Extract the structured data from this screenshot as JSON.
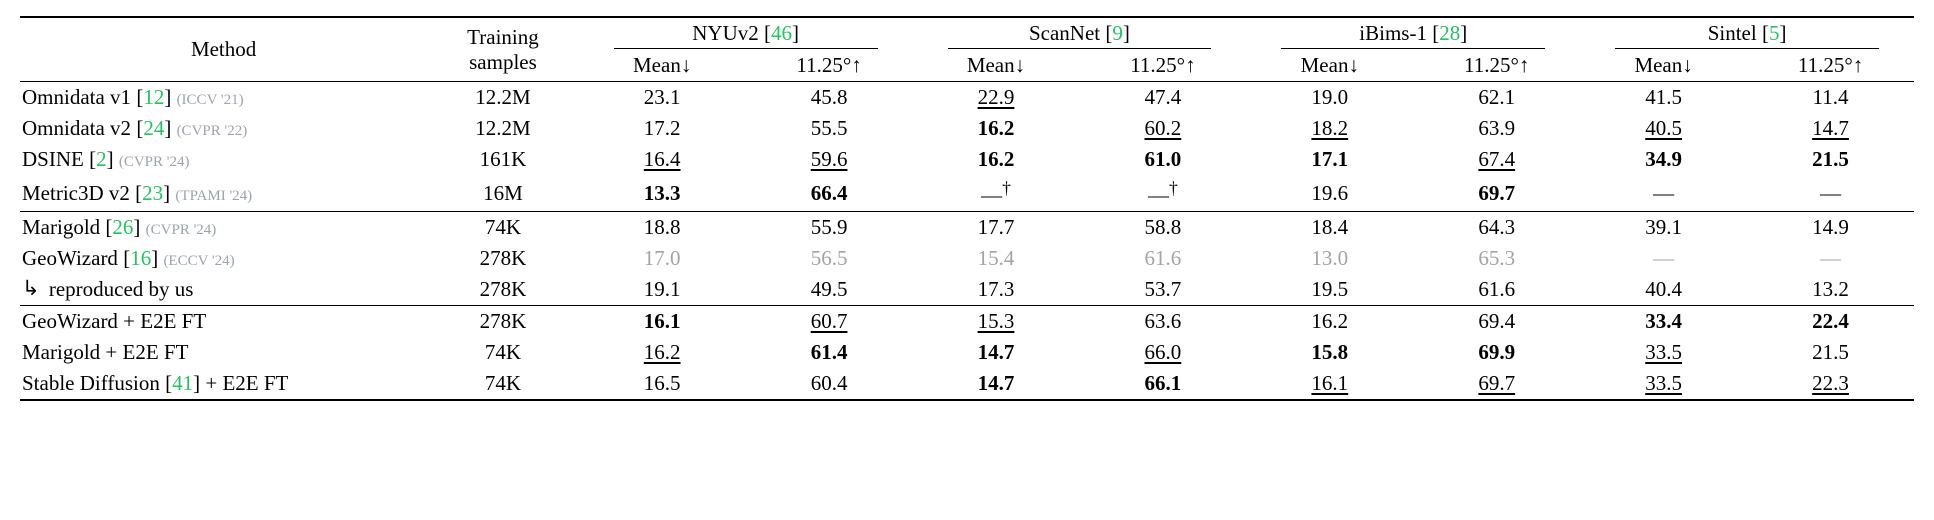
{
  "headers": {
    "method": "Method",
    "training": "Training",
    "samples": "samples",
    "mean": "Mean↓",
    "acc": "11.25°↑",
    "datasets": [
      {
        "name": "NYUv2",
        "ref": "46"
      },
      {
        "name": "ScanNet",
        "ref": "9"
      },
      {
        "name": "iBims-1",
        "ref": "28"
      },
      {
        "name": "Sintel",
        "ref": "5"
      }
    ]
  },
  "chart_data": {
    "type": "table",
    "title": "Surface normal estimation benchmark",
    "metrics_per_dataset": [
      "Mean↓",
      "11.25°↑"
    ],
    "datasets": [
      "NYUv2",
      "ScanNet",
      "iBims-1",
      "Sintel"
    ],
    "groups": [
      {
        "rows": [
          {
            "method": "Omnidata v1",
            "ref": "12",
            "venue": "(ICCV '21)",
            "samples": "12.2M",
            "cells": [
              {
                "v": "23.1"
              },
              {
                "v": "45.8"
              },
              {
                "v": "22.9",
                "u": true
              },
              {
                "v": "47.4"
              },
              {
                "v": "19.0"
              },
              {
                "v": "62.1"
              },
              {
                "v": "41.5"
              },
              {
                "v": "11.4"
              }
            ]
          },
          {
            "method": "Omnidata v2",
            "ref": "24",
            "venue": "(CVPR '22)",
            "samples": "12.2M",
            "cells": [
              {
                "v": "17.2"
              },
              {
                "v": "55.5"
              },
              {
                "v": "16.2",
                "b": true
              },
              {
                "v": "60.2",
                "u": true
              },
              {
                "v": "18.2",
                "u": true
              },
              {
                "v": "63.9"
              },
              {
                "v": "40.5",
                "u": true
              },
              {
                "v": "14.7",
                "u": true
              }
            ]
          },
          {
            "method": "DSINE",
            "ref": "2",
            "venue": "(CVPR '24)",
            "samples": "161K",
            "cells": [
              {
                "v": "16.4",
                "u": true
              },
              {
                "v": "59.6",
                "u": true
              },
              {
                "v": "16.2",
                "b": true
              },
              {
                "v": "61.0",
                "b": true
              },
              {
                "v": "17.1",
                "b": true
              },
              {
                "v": "67.4",
                "u": true
              },
              {
                "v": "34.9",
                "b": true
              },
              {
                "v": "21.5",
                "b": true
              }
            ]
          },
          {
            "method": "Metric3D v2",
            "ref": "23",
            "venue": "(TPAMI '24)",
            "samples": "16M",
            "cells": [
              {
                "v": "13.3",
                "b": true
              },
              {
                "v": "66.4",
                "b": true
              },
              {
                "v": "—",
                "dag": true
              },
              {
                "v": "—",
                "dag": true
              },
              {
                "v": "19.6"
              },
              {
                "v": "69.7",
                "b": true
              },
              {
                "v": "—"
              },
              {
                "v": "—"
              }
            ]
          }
        ]
      },
      {
        "rows": [
          {
            "method": "Marigold",
            "ref": "26",
            "venue": "(CVPR '24)",
            "samples": "74K",
            "cells": [
              {
                "v": "18.8"
              },
              {
                "v": "55.9"
              },
              {
                "v": "17.7"
              },
              {
                "v": "58.8"
              },
              {
                "v": "18.4"
              },
              {
                "v": "64.3"
              },
              {
                "v": "39.1"
              },
              {
                "v": "14.9"
              }
            ]
          },
          {
            "method": "GeoWizard",
            "ref": "16",
            "venue": "(ECCV '24)",
            "samples": "278K",
            "cells": [
              {
                "v": "17.0",
                "g": true
              },
              {
                "v": "56.5",
                "g": true
              },
              {
                "v": "15.4",
                "g": true
              },
              {
                "v": "61.6",
                "g": true
              },
              {
                "v": "13.0",
                "g": true
              },
              {
                "v": "65.3",
                "g": true
              },
              {
                "v": "—",
                "g": true
              },
              {
                "v": "—",
                "g": true
              }
            ]
          },
          {
            "method": "reproduced by us",
            "repro": true,
            "samples": "278K",
            "cells": [
              {
                "v": "19.1"
              },
              {
                "v": "49.5"
              },
              {
                "v": "17.3"
              },
              {
                "v": "53.7"
              },
              {
                "v": "19.5"
              },
              {
                "v": "61.6"
              },
              {
                "v": "40.4"
              },
              {
                "v": "13.2"
              }
            ]
          }
        ]
      },
      {
        "rows": [
          {
            "method": "GeoWizard + E2E FT",
            "samples": "278K",
            "cells": [
              {
                "v": "16.1",
                "b": true
              },
              {
                "v": "60.7",
                "u": true
              },
              {
                "v": "15.3",
                "u": true
              },
              {
                "v": "63.6"
              },
              {
                "v": "16.2"
              },
              {
                "v": "69.4"
              },
              {
                "v": "33.4",
                "b": true
              },
              {
                "v": "22.4",
                "b": true
              }
            ]
          },
          {
            "method": "Marigold + E2E FT",
            "samples": "74K",
            "cells": [
              {
                "v": "16.2",
                "u": true
              },
              {
                "v": "61.4",
                "b": true
              },
              {
                "v": "14.7",
                "b": true
              },
              {
                "v": "66.0",
                "u": true
              },
              {
                "v": "15.8",
                "b": true
              },
              {
                "v": "69.9",
                "b": true
              },
              {
                "v": "33.5",
                "u": true
              },
              {
                "v": "21.5"
              }
            ]
          },
          {
            "method": "Stable Diffusion",
            "ref": "41",
            "suffix": " + E2E FT",
            "samples": "74K",
            "cells": [
              {
                "v": "16.5"
              },
              {
                "v": "60.4"
              },
              {
                "v": "14.7",
                "b": true
              },
              {
                "v": "66.1",
                "b": true
              },
              {
                "v": "16.1",
                "u": true
              },
              {
                "v": "69.7",
                "u": true
              },
              {
                "v": "33.5",
                "u": true
              },
              {
                "v": "22.3",
                "u": true
              }
            ]
          }
        ]
      }
    ]
  },
  "glyphs": {
    "hook": "↳",
    "dagger": "†"
  }
}
